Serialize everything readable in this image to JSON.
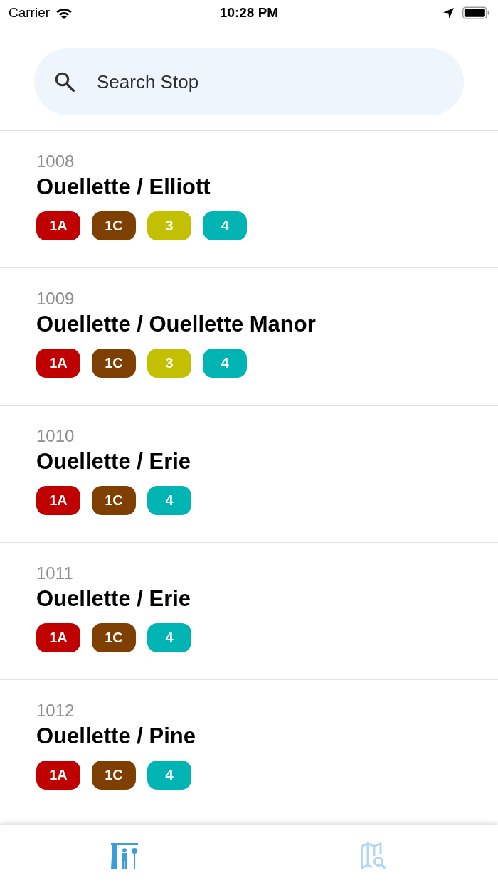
{
  "status_bar": {
    "carrier": "Carrier",
    "time": "10:28 PM"
  },
  "search": {
    "placeholder": "Search Stop"
  },
  "stops": [
    {
      "number": "1008",
      "name": "Ouellette / Elliott",
      "routes": [
        {
          "label": "1A",
          "color": "#c00000"
        },
        {
          "label": "1C",
          "color": "#7f3f00"
        },
        {
          "label": "3",
          "color": "#c2c000"
        },
        {
          "label": "4",
          "color": "#00b4b4"
        }
      ]
    },
    {
      "number": "1009",
      "name": "Ouellette / Ouellette Manor",
      "routes": [
        {
          "label": "1A",
          "color": "#c00000"
        },
        {
          "label": "1C",
          "color": "#7f3f00"
        },
        {
          "label": "3",
          "color": "#c2c000"
        },
        {
          "label": "4",
          "color": "#00b4b4"
        }
      ]
    },
    {
      "number": "1010",
      "name": "Ouellette / Erie",
      "routes": [
        {
          "label": "1A",
          "color": "#c00000"
        },
        {
          "label": "1C",
          "color": "#7f3f00"
        },
        {
          "label": "4",
          "color": "#00b4b4"
        }
      ]
    },
    {
      "number": "1011",
      "name": "Ouellette / Erie",
      "routes": [
        {
          "label": "1A",
          "color": "#c00000"
        },
        {
          "label": "1C",
          "color": "#7f3f00"
        },
        {
          "label": "4",
          "color": "#00b4b4"
        }
      ]
    },
    {
      "number": "1012",
      "name": "Ouellette / Pine",
      "routes": [
        {
          "label": "1A",
          "color": "#c00000"
        },
        {
          "label": "1C",
          "color": "#7f3f00"
        },
        {
          "label": "4",
          "color": "#00b4b4"
        }
      ]
    }
  ],
  "tabs": [
    {
      "kind": "stops",
      "selected": true
    },
    {
      "kind": "map",
      "selected": false
    }
  ]
}
